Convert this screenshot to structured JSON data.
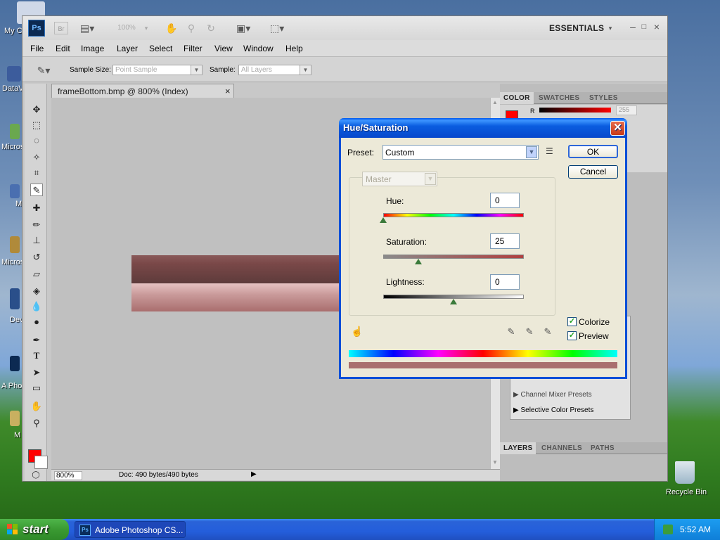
{
  "desktop": {
    "labels": [
      "My C",
      "DataV",
      "Micros C+",
      "M",
      "Micros Bas",
      "Dev",
      "A Photo",
      "M"
    ],
    "recycle_bin": "Recycle Bin"
  },
  "taskbar": {
    "start": "start",
    "app": "Adobe Photoshop CS...",
    "time": "5:52 AM"
  },
  "photoshop": {
    "logo": "Ps",
    "zoom_field": "100%",
    "workspace": "ESSENTIALS",
    "menu": [
      "File",
      "Edit",
      "Image",
      "Layer",
      "Select",
      "Filter",
      "View",
      "Window",
      "Help"
    ],
    "options": {
      "sample_size_label": "Sample Size:",
      "sample_size_value": "Point Sample",
      "sample_label": "Sample:",
      "sample_value": "All Layers"
    },
    "doc_tab": "frameBottom.bmp @ 800% (Index)",
    "status_zoom": "800%",
    "status_doc": "Doc: 490 bytes/490 bytes",
    "panel_tabs_top": [
      "COLOR",
      "SWATCHES",
      "STYLES"
    ],
    "color_r_label": "R",
    "color_r_value": "255",
    "adjustments": [
      "Channel Mixer Presets",
      "Selective Color Presets"
    ],
    "panel_tabs_bottom": [
      "LAYERS",
      "CHANNELS",
      "PATHS"
    ]
  },
  "dialog": {
    "title": "Hue/Saturation",
    "preset_label": "Preset:",
    "preset_value": "Custom",
    "channel": "Master",
    "hue_label": "Hue:",
    "hue_value": "0",
    "saturation_label": "Saturation:",
    "saturation_value": "25",
    "lightness_label": "Lightness:",
    "lightness_value": "0",
    "ok": "OK",
    "cancel": "Cancel",
    "colorize": "Colorize",
    "preview": "Preview",
    "colorize_checked": true,
    "preview_checked": true
  },
  "colors": {
    "foreground": "#ff0000",
    "canvas_dark": "#5e3b3b",
    "canvas_light": "#c99a9a",
    "xp_blue": "#0a5de0"
  }
}
